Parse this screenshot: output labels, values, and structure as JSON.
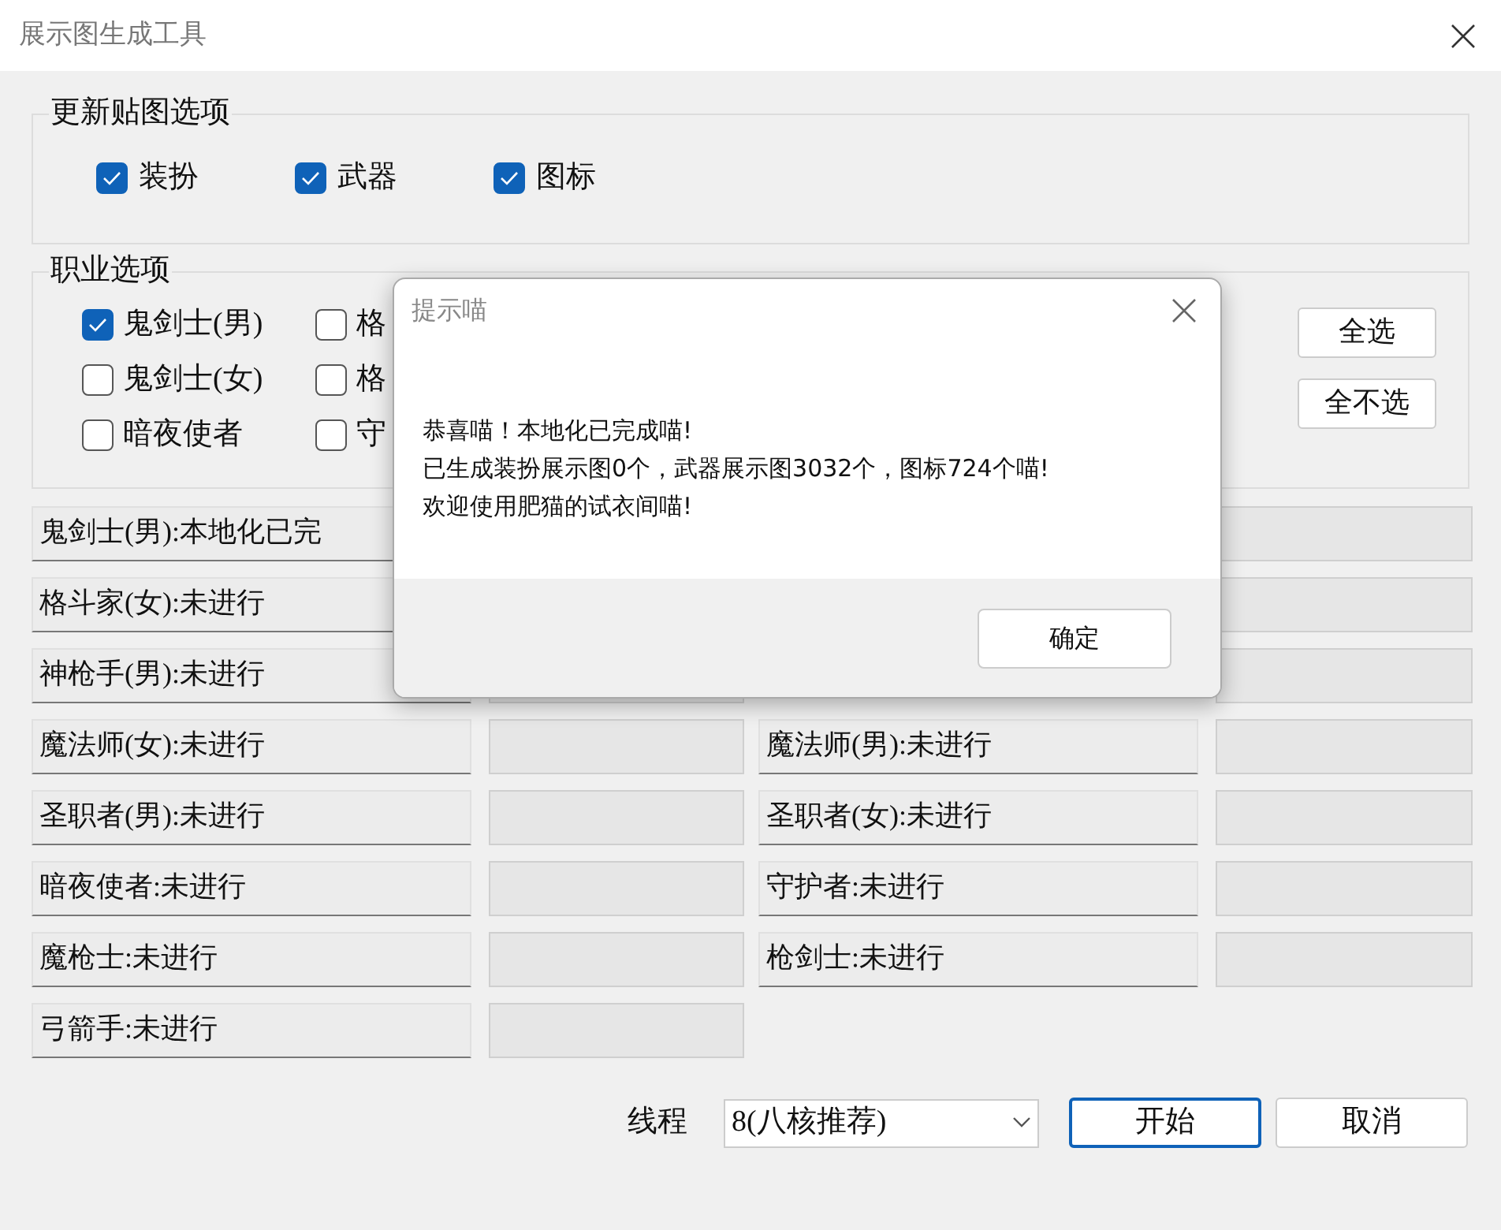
{
  "window": {
    "title": "展示图生成工具"
  },
  "texture_group": {
    "title": "更新贴图选项",
    "options": [
      {
        "label": "装扮",
        "checked": true
      },
      {
        "label": "武器",
        "checked": true
      },
      {
        "label": "图标",
        "checked": true
      }
    ]
  },
  "class_group": {
    "title": "职业选项",
    "columns": [
      [
        {
          "label": "鬼剑士(男)",
          "checked": true
        },
        {
          "label": "鬼剑士(女)",
          "checked": false
        },
        {
          "label": "暗夜使者",
          "checked": false
        }
      ],
      [
        {
          "label": "格",
          "checked": false
        },
        {
          "label": "格",
          "checked": false
        },
        {
          "label": "守",
          "checked": false
        }
      ]
    ],
    "buttons": [
      "全选",
      "全不选"
    ]
  },
  "status_rows": [
    {
      "left": {
        "label": "鬼剑士(男):本地化已完"
      },
      "right": {
        "level": 0
      }
    },
    {
      "left": {
        "label": "格斗家(女):未进行"
      },
      "right": {
        "level": 0
      }
    },
    {
      "left": {
        "label": "神枪手(男):未进行",
        "level": 0
      },
      "right": {
        "level": 0
      }
    },
    {
      "left": {
        "label": "魔法师(女):未进行",
        "level": 0
      },
      "right": {
        "label": "魔法师(男):未进行",
        "level": 0
      }
    },
    {
      "left": {
        "label": "圣职者(男):未进行",
        "level": 0
      },
      "right": {
        "label": "圣职者(女):未进行",
        "level": 0
      }
    },
    {
      "left": {
        "label": "暗夜使者:未进行",
        "level": 0
      },
      "right": {
        "label": "守护者:未进行",
        "level": 0
      }
    },
    {
      "left": {
        "label": "魔枪士:未进行",
        "level": 0
      },
      "right": {
        "label": "枪剑士:未进行",
        "level": 0
      }
    },
    {
      "left": {
        "label": "弓箭手:未进行",
        "level": 0
      }
    }
  ],
  "footer": {
    "threads_label": "线程",
    "threads_value": "8(八核推荐)",
    "buttons": [
      {
        "label": "开始",
        "focused": true
      },
      {
        "label": "取消",
        "focused": false
      }
    ]
  },
  "dialog": {
    "title": "提示喵",
    "message": [
      "恭喜喵！本地化已完成喵!",
      "已生成装扮展示图0个，武器展示图3032个，图标724个喵!",
      "欢迎使用肥猫的试衣间喵!"
    ],
    "ok_button": "确定"
  }
}
